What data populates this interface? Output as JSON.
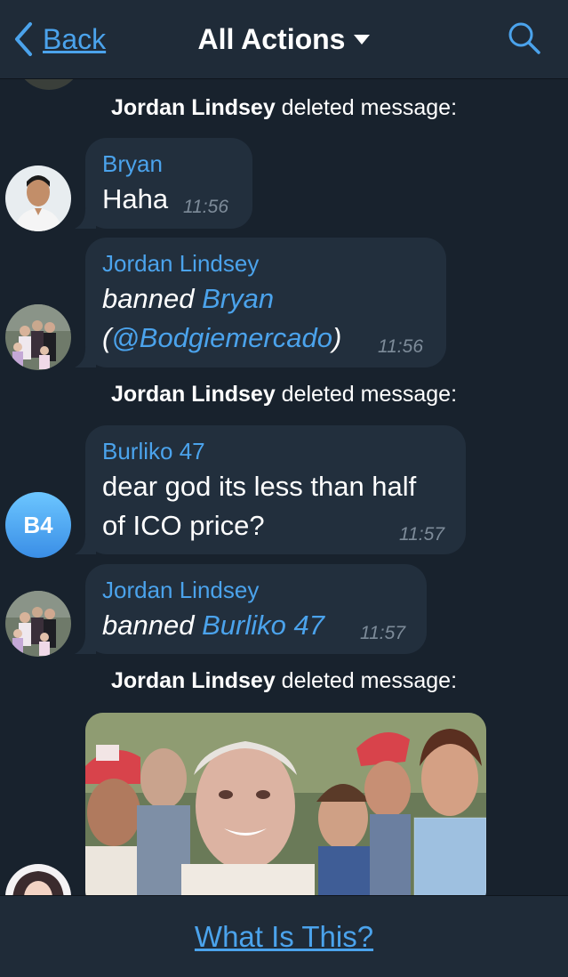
{
  "header": {
    "back_label": "Back",
    "title": "All Actions",
    "icons": {
      "back": "chevron-left-icon",
      "title_caret": "caret-down-icon",
      "search": "search-icon"
    }
  },
  "messages": [
    {
      "type": "service",
      "actor": "Jordan Lindsey",
      "action": "deleted message:"
    },
    {
      "type": "message",
      "sender": "Bryan",
      "text": "Haha",
      "time": "11:56"
    },
    {
      "type": "message",
      "sender": "Jordan Lindsey",
      "verb": "banned",
      "target_name": "Bryan",
      "open_paren": "(",
      "target_handle": "@Bodgiemercado",
      "close_paren": ")",
      "time": "11:56"
    },
    {
      "type": "service",
      "actor": "Jordan Lindsey",
      "action": "deleted message:"
    },
    {
      "type": "message",
      "sender": "Burliko 47",
      "avatar_initials": "B4",
      "text_line1": "dear god its less than half",
      "text_line2": "of ICO price?",
      "time": "11:57"
    },
    {
      "type": "message",
      "sender": "Jordan Lindsey",
      "verb": "banned",
      "target_name": "Burliko 47",
      "time": "11:57"
    },
    {
      "type": "service",
      "actor": "Jordan Lindsey",
      "action": "deleted message:"
    },
    {
      "type": "media",
      "description_icon": "photo-icon"
    }
  ],
  "footer": {
    "label": "What Is This?"
  },
  "colors": {
    "background": "#18222d",
    "bar": "#1f2b38",
    "bubble": "#222f3d",
    "accent": "#4ba3ec",
    "time": "#7d8b99"
  }
}
